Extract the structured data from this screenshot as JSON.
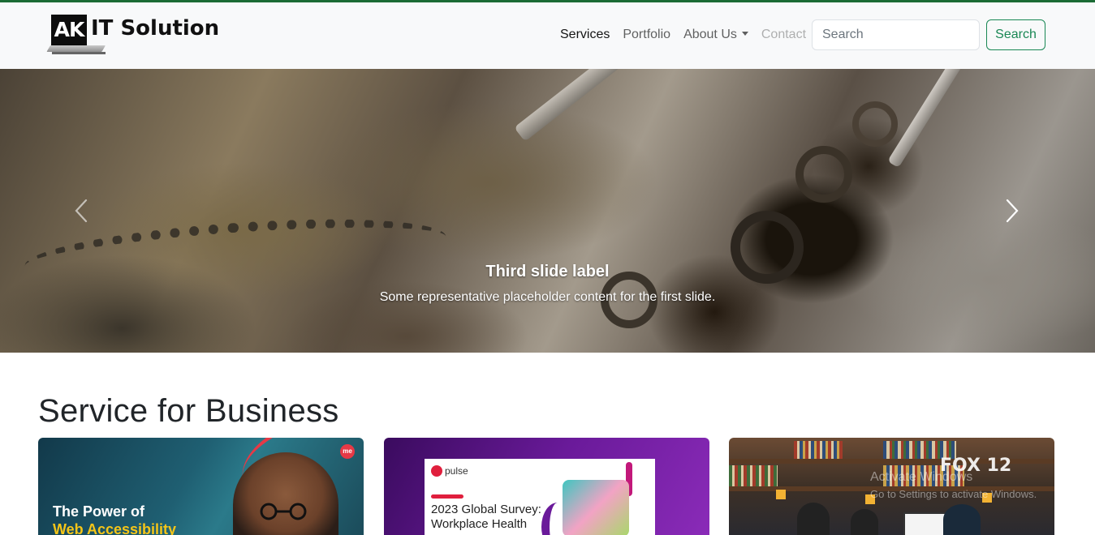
{
  "brand": {
    "logo_text": "AK",
    "name": "IT Solution"
  },
  "nav": {
    "items": [
      {
        "label": "Services",
        "state": "active"
      },
      {
        "label": "Portfolio",
        "state": "normal"
      },
      {
        "label": "About Us",
        "state": "dropdown"
      },
      {
        "label": "Contact",
        "state": "disabled"
      }
    ],
    "search_placeholder": "Search",
    "search_button": "Search"
  },
  "carousel": {
    "caption_title": "Third slide label",
    "caption_text": "Some representative placeholder content for the first slide.",
    "prev_icon": "chevron-left-icon",
    "next_icon": "chevron-right-icon"
  },
  "section": {
    "title": "Service for Business"
  },
  "cards": [
    {
      "line1": "The Power of",
      "line2": "Web Accessibility",
      "badge": "me"
    },
    {
      "brand": "pulse",
      "title_line1": "2023 Global Survey:",
      "title_line2": "Workplace Health"
    },
    {
      "logo": "FOX 12"
    }
  ],
  "os_watermark": {
    "line1": "Activate Windows",
    "line2": "Go to Settings to activate Windows."
  },
  "colors": {
    "accent": "#198754",
    "top_border": "#1b6b35",
    "navbar_bg": "#f8f9fa"
  }
}
